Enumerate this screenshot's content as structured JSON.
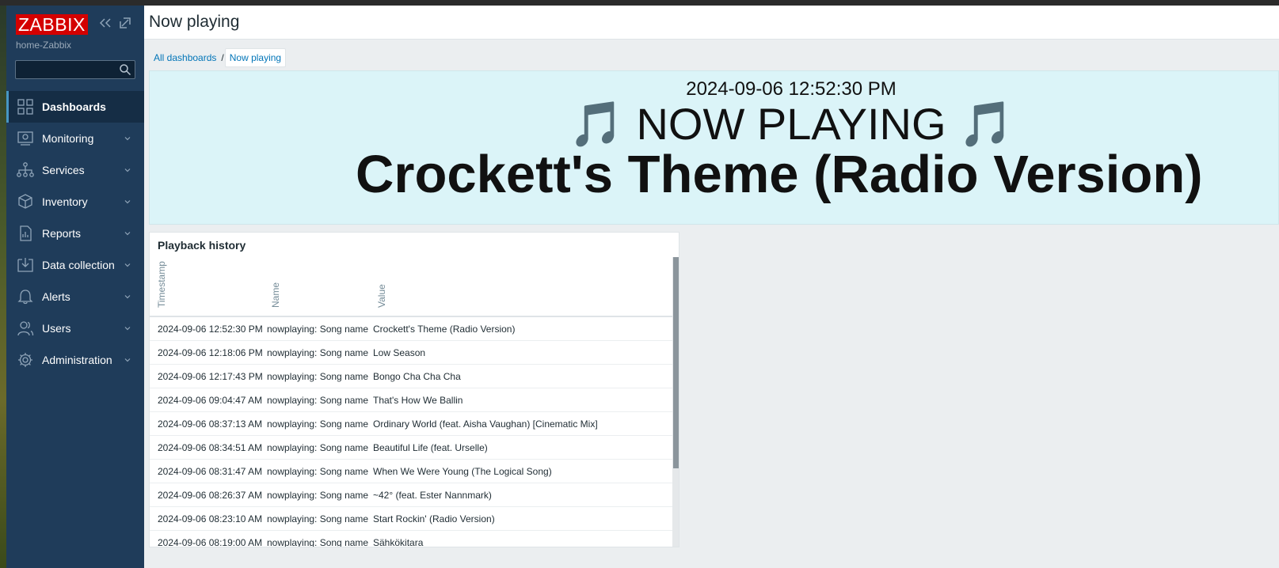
{
  "app": {
    "logo": "ZABBIX",
    "server_name": "home-Zabbix",
    "search_placeholder": ""
  },
  "sidebar": {
    "items": [
      {
        "label": "Dashboards",
        "icon": "dashboards-icon",
        "active": true
      },
      {
        "label": "Monitoring",
        "icon": "monitoring-icon"
      },
      {
        "label": "Services",
        "icon": "services-icon"
      },
      {
        "label": "Inventory",
        "icon": "inventory-icon"
      },
      {
        "label": "Reports",
        "icon": "reports-icon"
      },
      {
        "label": "Data collection",
        "icon": "data-collection-icon"
      },
      {
        "label": "Alerts",
        "icon": "alerts-icon"
      },
      {
        "label": "Users",
        "icon": "users-icon"
      },
      {
        "label": "Administration",
        "icon": "administration-icon"
      }
    ]
  },
  "header": {
    "title": "Now playing"
  },
  "breadcrumb": {
    "parent": "All dashboards",
    "separator": "/",
    "current": "Now playing"
  },
  "banner": {
    "timestamp": "2024-09-06 12:52:30 PM",
    "heading": "🎵 NOW PLAYING 🎵",
    "song": "Crockett's Theme (Radio Version)"
  },
  "history": {
    "title": "Playback history",
    "columns": [
      "Timestamp",
      "Name",
      "Value"
    ],
    "rows": [
      {
        "timestamp": "2024-09-06 12:52:30 PM",
        "name": "nowplaying: Song name",
        "value": "Crockett's Theme (Radio Version)"
      },
      {
        "timestamp": "2024-09-06 12:18:06 PM",
        "name": "nowplaying: Song name",
        "value": "Low Season"
      },
      {
        "timestamp": "2024-09-06 12:17:43 PM",
        "name": "nowplaying: Song name",
        "value": "Bongo Cha Cha Cha"
      },
      {
        "timestamp": "2024-09-06 09:04:47 AM",
        "name": "nowplaying: Song name",
        "value": "That's How We Ballin"
      },
      {
        "timestamp": "2024-09-06 08:37:13 AM",
        "name": "nowplaying: Song name",
        "value": "Ordinary World (feat. Aisha Vaughan) [Cinematic Mix]"
      },
      {
        "timestamp": "2024-09-06 08:34:51 AM",
        "name": "nowplaying: Song name",
        "value": "Beautiful Life (feat. Urselle)"
      },
      {
        "timestamp": "2024-09-06 08:31:47 AM",
        "name": "nowplaying: Song name",
        "value": "When We Were Young (The Logical Song)"
      },
      {
        "timestamp": "2024-09-06 08:26:37 AM",
        "name": "nowplaying: Song name",
        "value": "~42° (feat. Ester Nannmark)"
      },
      {
        "timestamp": "2024-09-06 08:23:10 AM",
        "name": "nowplaying: Song name",
        "value": "Start Rockin' (Radio Version)"
      },
      {
        "timestamp": "2024-09-06 08:19:00 AM",
        "name": "nowplaying: Song name",
        "value": "Sähkökitara"
      }
    ]
  },
  "colors": {
    "sidebar_bg": "#1f3c5a",
    "logo_red": "#d40000",
    "banner_bg": "#dbf4f8",
    "link_blue": "#0275b8"
  }
}
